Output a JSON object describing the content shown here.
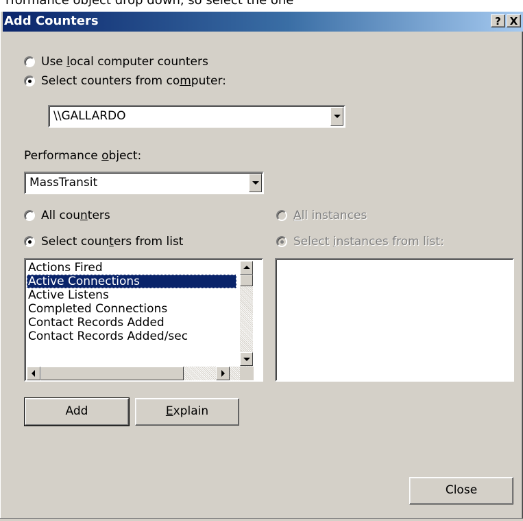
{
  "top_strip": {
    "text": "rformance object drop down, so select the one"
  },
  "window": {
    "title": "Add Counters",
    "help_button": "?",
    "close_button": "X"
  },
  "computer": {
    "use_local_label": "Use local computer counters",
    "select_from_label": "Select counters from computer:",
    "selected_option": "local_or_select",
    "computer_value": "\\\\GALLARDO"
  },
  "performance_object": {
    "label": "Performance object:",
    "value": "MassTransit"
  },
  "counters": {
    "all_label": "All counters",
    "select_label": "Select counters from list",
    "items": [
      "Actions Fired",
      "Active Connections",
      "Active Listens",
      "Completed Connections",
      "Contact Records Added",
      "Contact Records Added/sec"
    ],
    "selected_index": 1
  },
  "instances": {
    "all_label": "All instances",
    "select_label": "Select instances from list:"
  },
  "buttons": {
    "add": "Add",
    "explain": "Explain",
    "close": "Close"
  }
}
